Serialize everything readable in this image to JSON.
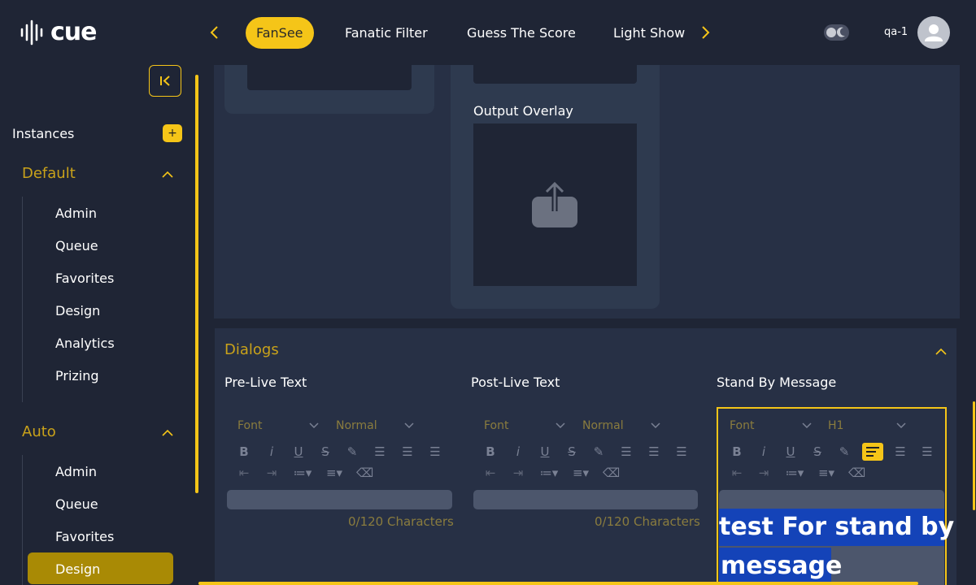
{
  "brand": {
    "name": "cue"
  },
  "header": {
    "tabs": [
      {
        "label": "FanSee",
        "active": true
      },
      {
        "label": "Fanatic Filter",
        "active": false
      },
      {
        "label": "Guess The Score",
        "active": false
      },
      {
        "label": "Light Show",
        "active": false
      }
    ],
    "prev_icon": "chevron-left-icon",
    "next_icon": "chevron-right-icon",
    "theme_toggle_icon": "moon-icon",
    "user": {
      "name": "qa-1",
      "avatar_icon": "user-icon"
    }
  },
  "sidebar": {
    "collapse_icon": "collapse-left-icon",
    "instances_label": "Instances",
    "add_label": "+",
    "groups": [
      {
        "label": "Default",
        "expanded": true,
        "items": [
          "Admin",
          "Queue",
          "Favorites",
          "Design",
          "Analytics",
          "Prizing"
        ]
      },
      {
        "label": "Auto",
        "expanded": true,
        "items": [
          "Admin",
          "Queue",
          "Favorites",
          "Design"
        ],
        "active_item": "Design"
      }
    ]
  },
  "main": {
    "output_overlay": {
      "label": "Output Overlay",
      "upload_icon": "upload-icon"
    },
    "dialogs": {
      "title": "Dialogs",
      "columns": [
        {
          "title": "Pre-Live Text",
          "font": "Font",
          "size": "Normal",
          "counter": "0/120 Characters"
        },
        {
          "title": "Post-Live Text",
          "font": "Font",
          "size": "Normal",
          "counter": "0/120 Characters"
        },
        {
          "title": "Stand By Message",
          "font": "Font",
          "size": "H1",
          "content_line1": " test For stand by",
          "content_line2": "message"
        }
      ]
    }
  },
  "colors": {
    "accent": "#f5c518",
    "accent_dark": "#a98a05",
    "background": "#1f2535",
    "panel": "#273045",
    "group_label": "#c9a21a",
    "selection": "#1443b8"
  }
}
